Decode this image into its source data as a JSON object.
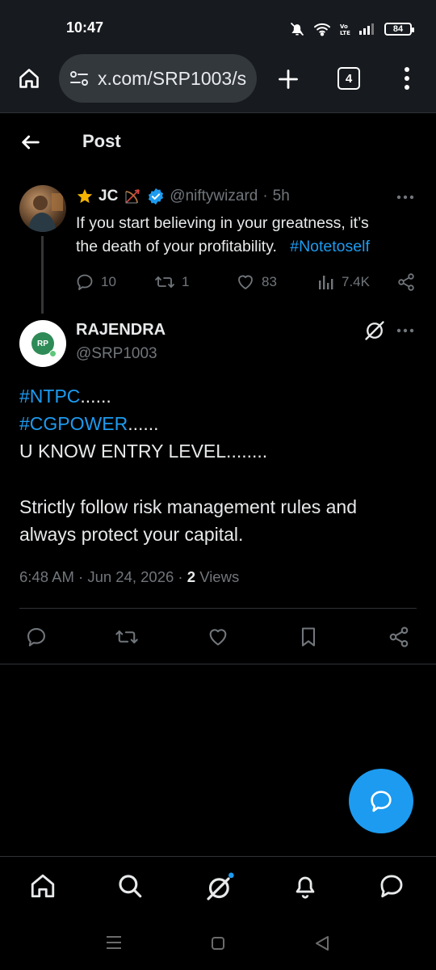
{
  "status_bar": {
    "time": "10:47",
    "battery": "84",
    "icons": [
      "mute-icon",
      "wifi-icon",
      "volte-icon",
      "signal-icon",
      "battery-icon"
    ]
  },
  "browser": {
    "url": "x.com/SRP1003/s",
    "tab_count": "4",
    "icons": [
      "home-icon",
      "site-settings-icon",
      "new-tab-icon",
      "tabs-icon",
      "overflow-menu-icon"
    ]
  },
  "header": {
    "title": "Post"
  },
  "parent_tweet": {
    "name": "JC",
    "handle": "@niftywizard",
    "separator": "·",
    "time": "5h",
    "text_line1": "If you start believing in your greatness, it’s",
    "text_line2": "the death of your profitability.",
    "hashtag": "#Notetoself",
    "replies": "10",
    "reposts": "1",
    "likes": "83",
    "views": "7.4K"
  },
  "main_tweet": {
    "name": "RAJENDRA",
    "handle": "@SRP1003",
    "avatar_text": "RP",
    "hashtag1": "#NTPC",
    "hashtag1_suffix": "......",
    "hashtag2": "#CGPOWER",
    "hashtag2_suffix": "......",
    "line3": "U KNOW ENTRY LEVEL........",
    "line4": "Strictly follow risk management rules and",
    "line5": "always protect your capital.",
    "timestamp": "6:48 AM · Jun 24, 2026 ·",
    "views_count": "2",
    "views_label": "Views"
  },
  "colors": {
    "background": "#000000",
    "accent": "#1d9bf0",
    "text": "#e7e9ea",
    "muted": "#71767b",
    "divider": "#2f3336",
    "chrome": "#171b1f"
  }
}
